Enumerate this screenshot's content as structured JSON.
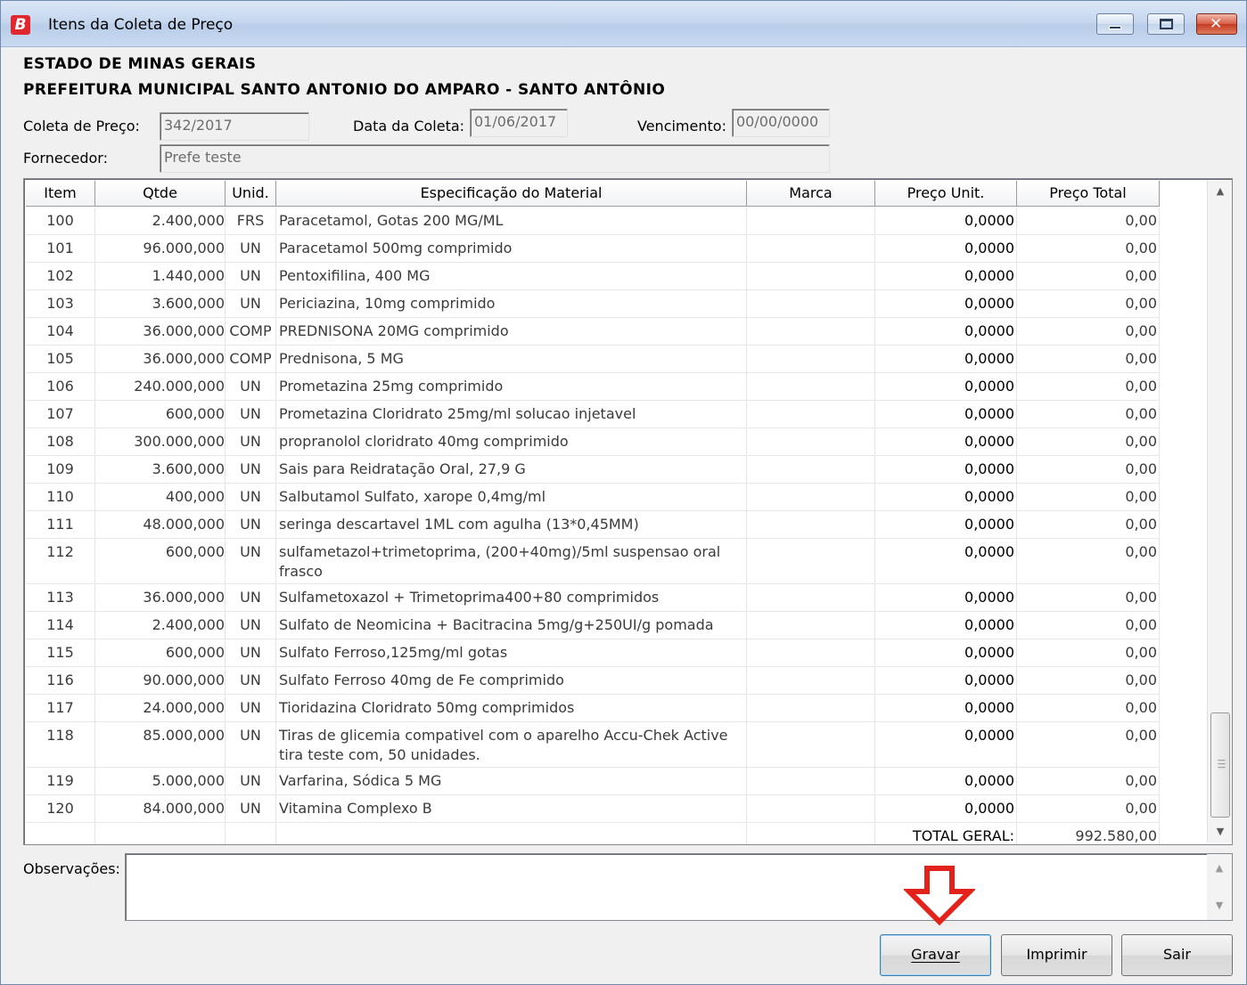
{
  "window": {
    "title": "Itens da Coleta de Preço",
    "app_icon_letter": "B",
    "close_glyph": "✕"
  },
  "header": {
    "line1": "ESTADO DE MINAS GERAIS",
    "line2": "PREFEITURA MUNICIPAL SANTO ANTONIO DO AMPARO - SANTO ANTÔNIO"
  },
  "form": {
    "coleta_label": "Coleta de Preço:",
    "coleta_value": "342/2017",
    "data_label": "Data da Coleta:",
    "data_value": "01/06/2017",
    "venc_label": "Vencimento:",
    "venc_value": "00/00/0000",
    "fornecedor_label": "Fornecedor:",
    "fornecedor_value": "Prefe teste"
  },
  "table": {
    "columns": [
      "Item",
      "Qtde",
      "Unid.",
      "Especificação do Material",
      "Marca",
      "Preço Unit.",
      "Preço Total"
    ],
    "rows": [
      {
        "item": "100",
        "qtde": "2.400,000",
        "unid": "FRS",
        "spec": "Paracetamol, Gotas 200 MG/ML",
        "marca": "",
        "unit": "0,0000",
        "total": "0,00"
      },
      {
        "item": "101",
        "qtde": "96.000,000",
        "unid": "UN",
        "spec": "Paracetamol 500mg comprimido",
        "marca": "",
        "unit": "0,0000",
        "total": "0,00"
      },
      {
        "item": "102",
        "qtde": "1.440,000",
        "unid": "UN",
        "spec": "Pentoxifilina, 400 MG",
        "marca": "",
        "unit": "0,0000",
        "total": "0,00"
      },
      {
        "item": "103",
        "qtde": "3.600,000",
        "unid": "UN",
        "spec": "Periciazina, 10mg comprimido",
        "marca": "",
        "unit": "0,0000",
        "total": "0,00"
      },
      {
        "item": "104",
        "qtde": "36.000,000",
        "unid": "COMP",
        "spec": "PREDNISONA 20MG comprimido",
        "marca": "",
        "unit": "0,0000",
        "total": "0,00"
      },
      {
        "item": "105",
        "qtde": "36.000,000",
        "unid": "COMP",
        "spec": "Prednisona, 5 MG",
        "marca": "",
        "unit": "0,0000",
        "total": "0,00"
      },
      {
        "item": "106",
        "qtde": "240.000,000",
        "unid": "UN",
        "spec": "Prometazina  25mg comprimido",
        "marca": "",
        "unit": "0,0000",
        "total": "0,00"
      },
      {
        "item": "107",
        "qtde": "600,000",
        "unid": "UN",
        "spec": "Prometazina Cloridrato 25mg/ml solucao injetavel",
        "marca": "",
        "unit": "0,0000",
        "total": "0,00"
      },
      {
        "item": "108",
        "qtde": "300.000,000",
        "unid": "UN",
        "spec": "propranolol cloridrato 40mg comprimido",
        "marca": "",
        "unit": "0,0000",
        "total": "0,00"
      },
      {
        "item": "109",
        "qtde": "3.600,000",
        "unid": "UN",
        "spec": "Sais para Reidratação Oral, 27,9 G",
        "marca": "",
        "unit": "0,0000",
        "total": "0,00"
      },
      {
        "item": "110",
        "qtde": "400,000",
        "unid": "UN",
        "spec": "Salbutamol Sulfato, xarope 0,4mg/ml",
        "marca": "",
        "unit": "0,0000",
        "total": "0,00"
      },
      {
        "item": "111",
        "qtde": "48.000,000",
        "unid": "UN",
        "spec": "seringa descartavel 1ML com agulha (13*0,45MM)",
        "marca": "",
        "unit": "0,0000",
        "total": "0,00"
      },
      {
        "item": "112",
        "qtde": "600,000",
        "unid": "UN",
        "spec": "sulfametazol+trimetoprima, (200+40mg)/5ml  suspensao oral frasco",
        "marca": "",
        "unit": "0,0000",
        "total": "0,00"
      },
      {
        "item": "113",
        "qtde": "36.000,000",
        "unid": "UN",
        "spec": "Sulfametoxazol + Trimetoprima400+80 comprimidos",
        "marca": "",
        "unit": "0,0000",
        "total": "0,00"
      },
      {
        "item": "114",
        "qtde": "2.400,000",
        "unid": "UN",
        "spec": "Sulfato de Neomicina + Bacitracina 5mg/g+250UI/g pomada",
        "marca": "",
        "unit": "0,0000",
        "total": "0,00"
      },
      {
        "item": "115",
        "qtde": "600,000",
        "unid": "UN",
        "spec": "Sulfato Ferroso,125mg/ml gotas",
        "marca": "",
        "unit": "0,0000",
        "total": "0,00"
      },
      {
        "item": "116",
        "qtde": "90.000,000",
        "unid": "UN",
        "spec": "Sulfato Ferroso 40mg de Fe comprimido",
        "marca": "",
        "unit": "0,0000",
        "total": "0,00"
      },
      {
        "item": "117",
        "qtde": "24.000,000",
        "unid": "UN",
        "spec": "Tioridazina Cloridrato 50mg comprimidos",
        "marca": "",
        "unit": "0,0000",
        "total": "0,00"
      },
      {
        "item": "118",
        "qtde": "85.000,000",
        "unid": "UN",
        "spec": "Tiras de glicemia compativel com o aparelho Accu-Chek Active tira teste com, 50 unidades.",
        "marca": "",
        "unit": "0,0000",
        "total": "0,00"
      },
      {
        "item": "119",
        "qtde": "5.000,000",
        "unid": "UN",
        "spec": "Varfarina, Sódica 5 MG",
        "marca": "",
        "unit": "0,0000",
        "total": "0,00"
      },
      {
        "item": "120",
        "qtde": "84.000,000",
        "unid": "UN",
        "spec": "Vitamina Complexo B",
        "marca": "",
        "unit": "0,0000",
        "total": "0,00"
      }
    ],
    "total_label": "TOTAL GERAL:",
    "total_value": "992.580,00"
  },
  "observacoes": {
    "label": "Observações:",
    "value": ""
  },
  "buttons": {
    "gravar": "Gravar",
    "imprimir": "Imprimir",
    "sair": "Sair"
  },
  "colors": {
    "annotation_arrow": "#e3231b",
    "title_icon": "#e0262f"
  },
  "icons": {
    "app": "b-logo-icon",
    "scroll_up": "▲",
    "scroll_down": "▼"
  }
}
